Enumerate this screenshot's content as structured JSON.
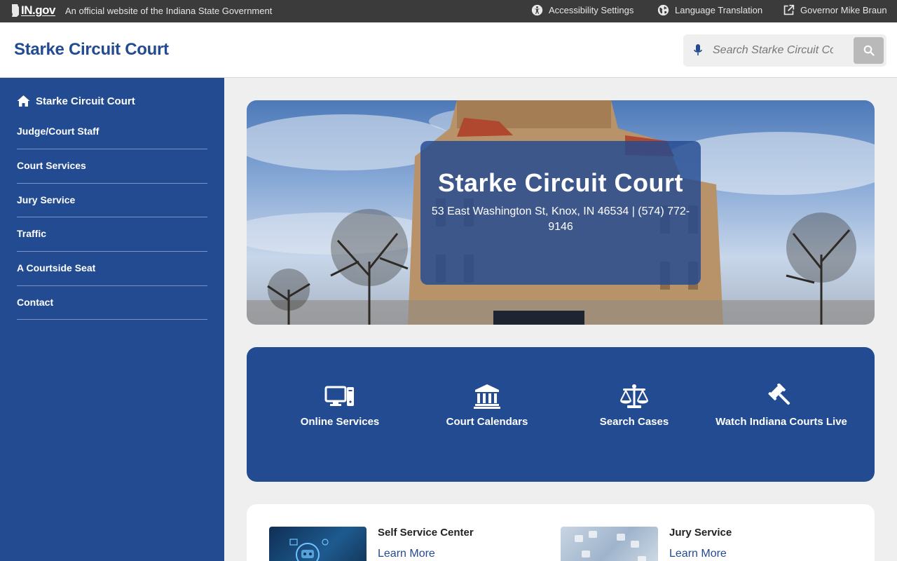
{
  "topbar": {
    "logo_text": "IN.gov",
    "official_text": "An official website of the Indiana State Government",
    "accessibility_label": "Accessibility Settings",
    "language_label": "Language Translation",
    "governor_label": "Governor Mike Braun"
  },
  "header": {
    "site_title": "Starke Circuit Court",
    "search_placeholder": "Search Starke Circuit Court"
  },
  "sidebar": {
    "home_label": "Starke Circuit Court",
    "items": [
      {
        "label": "Judge/Court Staff"
      },
      {
        "label": "Court Services"
      },
      {
        "label": "Jury Service"
      },
      {
        "label": "Traffic"
      },
      {
        "label": "A Courtside Seat"
      },
      {
        "label": "Contact"
      }
    ]
  },
  "hero": {
    "title": "Starke Circuit Court",
    "address": "53 East Washington St, Knox, IN 46534 | (574) 772-9146"
  },
  "quick_links": [
    {
      "label": "Online Services",
      "icon": "computer-icon"
    },
    {
      "label": "Court Calendars",
      "icon": "courthouse-icon"
    },
    {
      "label": "Search Cases",
      "icon": "scales-icon"
    },
    {
      "label": "Watch Indiana Courts Live",
      "icon": "gavel-icon"
    }
  ],
  "cards": [
    {
      "title": "Self Service Center",
      "link": "Learn More"
    },
    {
      "title": "Jury Service",
      "link": "Learn More"
    }
  ],
  "colors": {
    "brand_blue": "#234b91",
    "topbar_bg": "#3b3b3b",
    "page_bg": "#efefef"
  }
}
